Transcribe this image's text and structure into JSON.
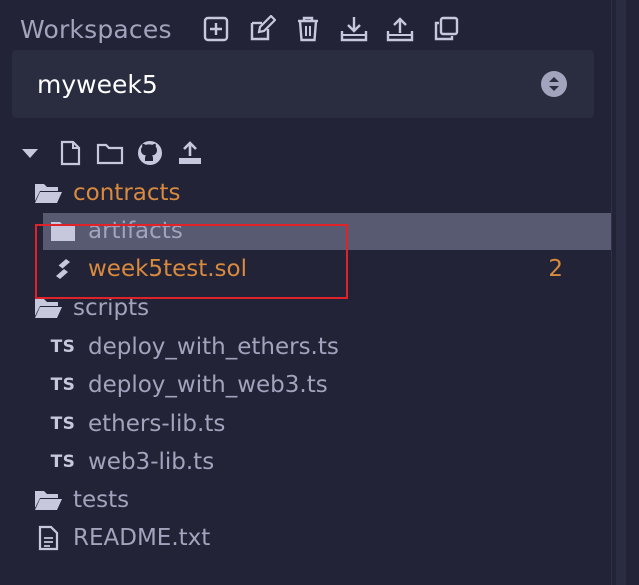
{
  "header": {
    "title": "Workspaces",
    "icons": [
      "plus-square-icon",
      "edit-icon",
      "trash-icon",
      "download-icon",
      "upload-icon",
      "copy-icon"
    ]
  },
  "workspace_select": {
    "value": "myweek5"
  },
  "toolbar": {
    "icons": [
      "caret-down-icon",
      "new-file-icon",
      "new-folder-icon",
      "github-icon",
      "upload-icon"
    ]
  },
  "tree": {
    "contracts": {
      "label": "contracts"
    },
    "artifacts": {
      "label": "artifacts"
    },
    "sol_file": {
      "label": "week5test.sol",
      "badge": "2"
    },
    "scripts": {
      "label": "scripts"
    },
    "script_files": [
      {
        "label": "deploy_with_ethers.ts",
        "icon": "TS"
      },
      {
        "label": "deploy_with_web3.ts",
        "icon": "TS"
      },
      {
        "label": "ethers-lib.ts",
        "icon": "TS"
      },
      {
        "label": "web3-lib.ts",
        "icon": "TS"
      }
    ],
    "tests": {
      "label": "tests"
    },
    "readme": {
      "label": "README.txt"
    }
  },
  "colors": {
    "background": "#222336",
    "text": "#a2a3bd",
    "accent": "#d88a3f",
    "selected": "#585a71",
    "highlight": "#e0222b"
  }
}
